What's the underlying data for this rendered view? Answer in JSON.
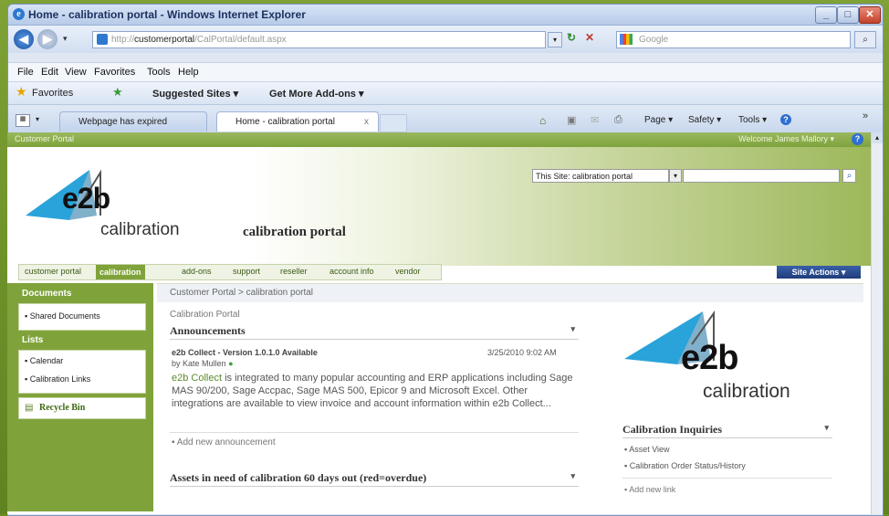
{
  "window": {
    "title": "Home - calibration portal - Windows Internet Explorer"
  },
  "address": {
    "prefix": "http://",
    "host": "customerportal",
    "path": "/CalPortal/default.aspx"
  },
  "browser_search": {
    "placeholder": "Google"
  },
  "menu": [
    "File",
    "Edit",
    "View",
    "Favorites",
    "Tools",
    "Help"
  ],
  "favorites_bar": {
    "favorites": "Favorites",
    "suggested": "Suggested Sites ▾",
    "addons": "Get More Add-ons ▾"
  },
  "tabs": [
    {
      "label": "Webpage has expired"
    },
    {
      "label": "Home - calibration portal"
    }
  ],
  "command_bar": {
    "page": "Page ▾",
    "safety": "Safety ▾",
    "tools": "Tools ▾"
  },
  "portal": {
    "site_label": "Customer Portal",
    "welcome": "Welcome James Mallory ▾",
    "logo_text": "e2b",
    "logo_sub": "calibration",
    "title": "calibration portal",
    "search_scope": "This Site: calibration portal",
    "nav": [
      "customer portal",
      "calibration",
      "add-ons",
      "support",
      "reseller",
      "account info",
      "vendor"
    ],
    "site_actions": "Site Actions ▾"
  },
  "quicklaunch": {
    "documents_head": "Documents",
    "documents": [
      "Shared Documents"
    ],
    "lists_head": "Lists",
    "lists": [
      "Calendar",
      "Calibration Links"
    ],
    "recycle": "Recycle Bin"
  },
  "content": {
    "breadcrumb_root": "Customer Portal",
    "breadcrumb_sep": " > ",
    "breadcrumb_leaf": "calibration portal",
    "page_title": "Calibration Portal",
    "announcements_head": "Announcements",
    "announcement": {
      "title": "e2b Collect - Version 1.0.1.0 Available",
      "date": "3/25/2010 9:02 AM",
      "author": "by Kate Mullen",
      "body_link": "e2b Collect",
      "body_rest": " is integrated to many popular accounting and ERP applications including Sage MAS 90/200, Sage Accpac, Sage MAS 500, Epicor 9 and Microsoft Excel. Other integrations are available to view invoice and account information within e2b Collect..."
    },
    "add_announcement": "Add new announcement",
    "assets_head": "Assets in need of calibration 60 days out (red=overdue)",
    "inquiries_head": "Calibration Inquiries",
    "inquiries": [
      "Asset View",
      "Calibration Order Status/History"
    ],
    "add_link": "Add new link"
  }
}
